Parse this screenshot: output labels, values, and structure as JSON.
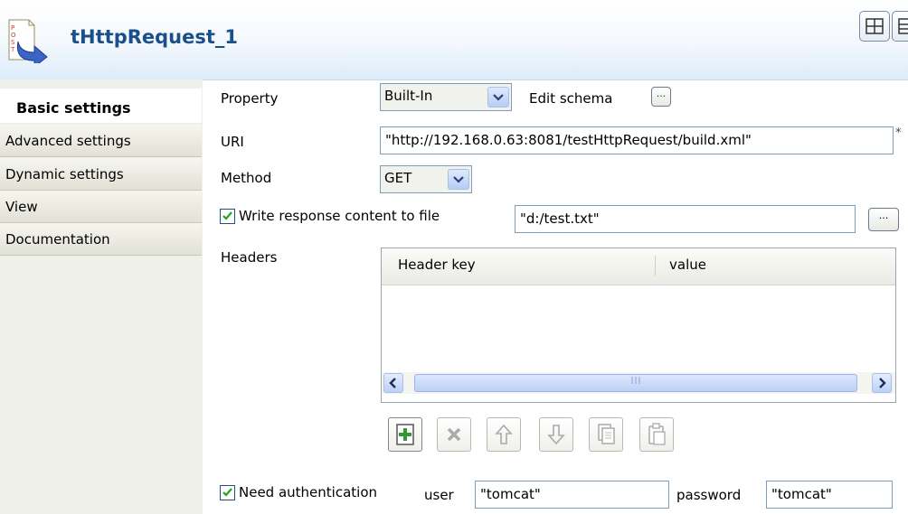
{
  "header": {
    "title": "tHttpRequest_1",
    "icon": "http-post-component-icon"
  },
  "sidebar": {
    "items": [
      {
        "label": "Basic settings",
        "active": true
      },
      {
        "label": "Advanced settings"
      },
      {
        "label": "Dynamic settings"
      },
      {
        "label": "View"
      },
      {
        "label": "Documentation"
      }
    ]
  },
  "form": {
    "property": {
      "label": "Property",
      "value": "Built-In"
    },
    "edit_schema": {
      "label": "Edit schema",
      "button": "..."
    },
    "uri": {
      "label": "URI",
      "value": "\"http://192.168.0.63:8081/testHttpRequest/build.xml\"",
      "required_mark": "*"
    },
    "method": {
      "label": "Method",
      "value": "GET"
    },
    "write_response": {
      "checked": true,
      "label": "Write response content to file",
      "value": "\"d:/test.txt\"",
      "button": "..."
    },
    "headers": {
      "label": "Headers",
      "columns": [
        "Header key",
        "value"
      ],
      "rows": []
    },
    "auth": {
      "checked": true,
      "label": "Need authentication",
      "user_label": "user",
      "user_value": "\"tomcat\"",
      "password_label": "password",
      "password_value": "\"tomcat\""
    }
  },
  "toolbar_icons": [
    "add-icon",
    "delete-icon",
    "move-up-icon",
    "move-down-icon",
    "copy-icon",
    "paste-icon"
  ],
  "colors": {
    "title": "#1b4f8a",
    "add_green": "#2f9a2f"
  }
}
